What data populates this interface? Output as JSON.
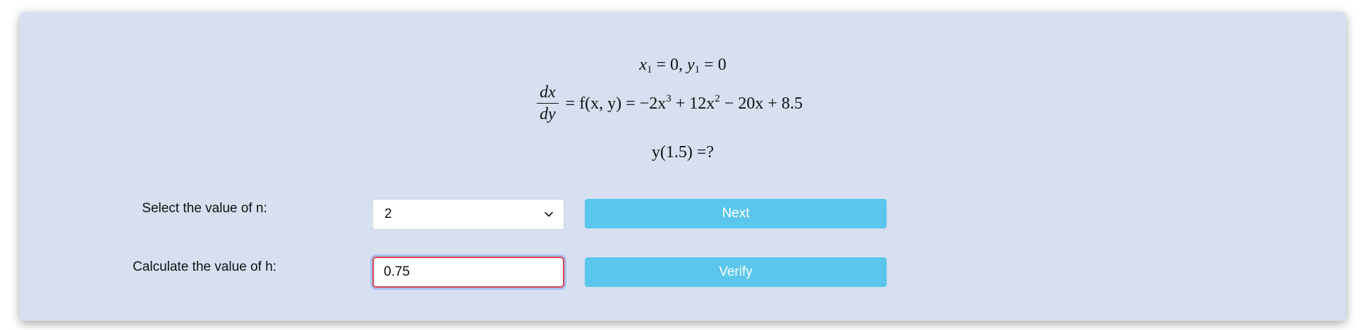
{
  "problem": {
    "initial_x_var": "x",
    "initial_x_sub": "1",
    "initial_x_val": " = 0, ",
    "initial_y_var": "y",
    "initial_y_sub": "1",
    "initial_y_val": " = 0",
    "deriv_num": "dx",
    "deriv_den": "dy",
    "eq_f": " = f(x, y) = −2x",
    "eq_p1": "3",
    "eq_m1": " + 12x",
    "eq_p2": "2",
    "eq_tail": " − 20x + 8.5",
    "question": "y(1.5) =?"
  },
  "form": {
    "n_label": "Select the value of n:",
    "n_selected": "2",
    "next_label": "Next",
    "h_label": "Calculate the value of h:",
    "h_value": "0.75",
    "verify_label": "Verify"
  },
  "colors": {
    "panel_bg": "#d6e0f0",
    "button_bg": "#5bc6ec",
    "input_error_border": "#d9434d",
    "focus_ring": "#a9bdf0"
  },
  "icons": {
    "select_arrow": "chevron-down-icon"
  }
}
